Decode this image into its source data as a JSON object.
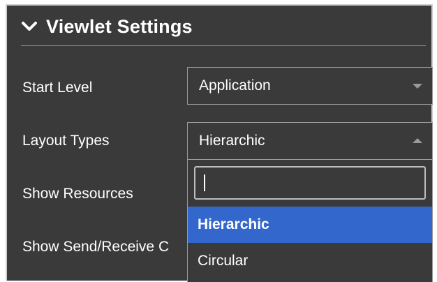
{
  "header": {
    "title": "Viewlet Settings",
    "collapse_icon": "chevron-down-icon"
  },
  "settings": {
    "start_level": {
      "label": "Start Level",
      "value": "Application"
    },
    "layout_types": {
      "label": "Layout Types",
      "value": "Hierarchic",
      "expanded": true,
      "search_value": "",
      "options": [
        {
          "label": "Hierarchic",
          "selected": true
        },
        {
          "label": "Circular",
          "selected": false
        }
      ]
    },
    "show_resources": {
      "label": "Show Resources"
    },
    "show_send_receive": {
      "label": "Show Send/Receive C"
    }
  },
  "colors": {
    "panel_bg": "#3a3a3a",
    "selected_option_bg": "#3367cc",
    "border": "#9a9a9a"
  }
}
